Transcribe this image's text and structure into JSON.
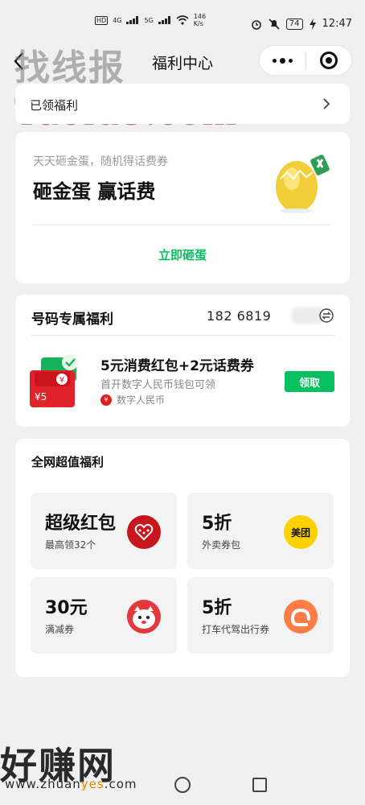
{
  "status_bar": {
    "left_labels": [
      "HD",
      "HD",
      "4G",
      "5G"
    ],
    "network_speed": "146",
    "network_speed_unit": "K/s",
    "battery": "74",
    "time": "12:47"
  },
  "header": {
    "title": "福利中心",
    "icons": [
      "back-icon",
      "more-icon",
      "close-icon"
    ]
  },
  "watermarks": {
    "top": "找线报",
    "top2": "Taolu5.com",
    "bottom": "好赚网",
    "bottom_url_a": "www.zhuan",
    "bottom_url_b": "yes",
    "bottom_url_c": ".com"
  },
  "claimed": {
    "label": "已领福利"
  },
  "egg_game": {
    "subtitle": "天天砸金蛋，随机得话费券",
    "title": "砸金蛋 赢话费",
    "button": "立即砸蛋"
  },
  "number_benefits": {
    "title": "号码专属福利",
    "phone": "182 6819",
    "offer": {
      "title": "5元消费红包+2元话费券",
      "subtitle": "首开数字人民币钱包可领",
      "source": "数字人民币",
      "amount_label": "¥5",
      "claim_button": "领取"
    }
  },
  "all_benefits": {
    "title": "全网超值福利",
    "tiles": [
      {
        "big": "超级红包",
        "small": "最高领32个",
        "logo": "red-envelope-icon"
      },
      {
        "big": "5折",
        "small": "外卖券包",
        "logo_text": "美团"
      },
      {
        "big": "30元",
        "small": "满减券",
        "logo": "jd-mascot-icon"
      },
      {
        "big": "5折",
        "small": "打车代驾出行券",
        "logo": "didi-icon"
      }
    ]
  },
  "colors": {
    "accent_green": "#07c160",
    "background": "#f0f0f0",
    "card": "#ffffff"
  }
}
